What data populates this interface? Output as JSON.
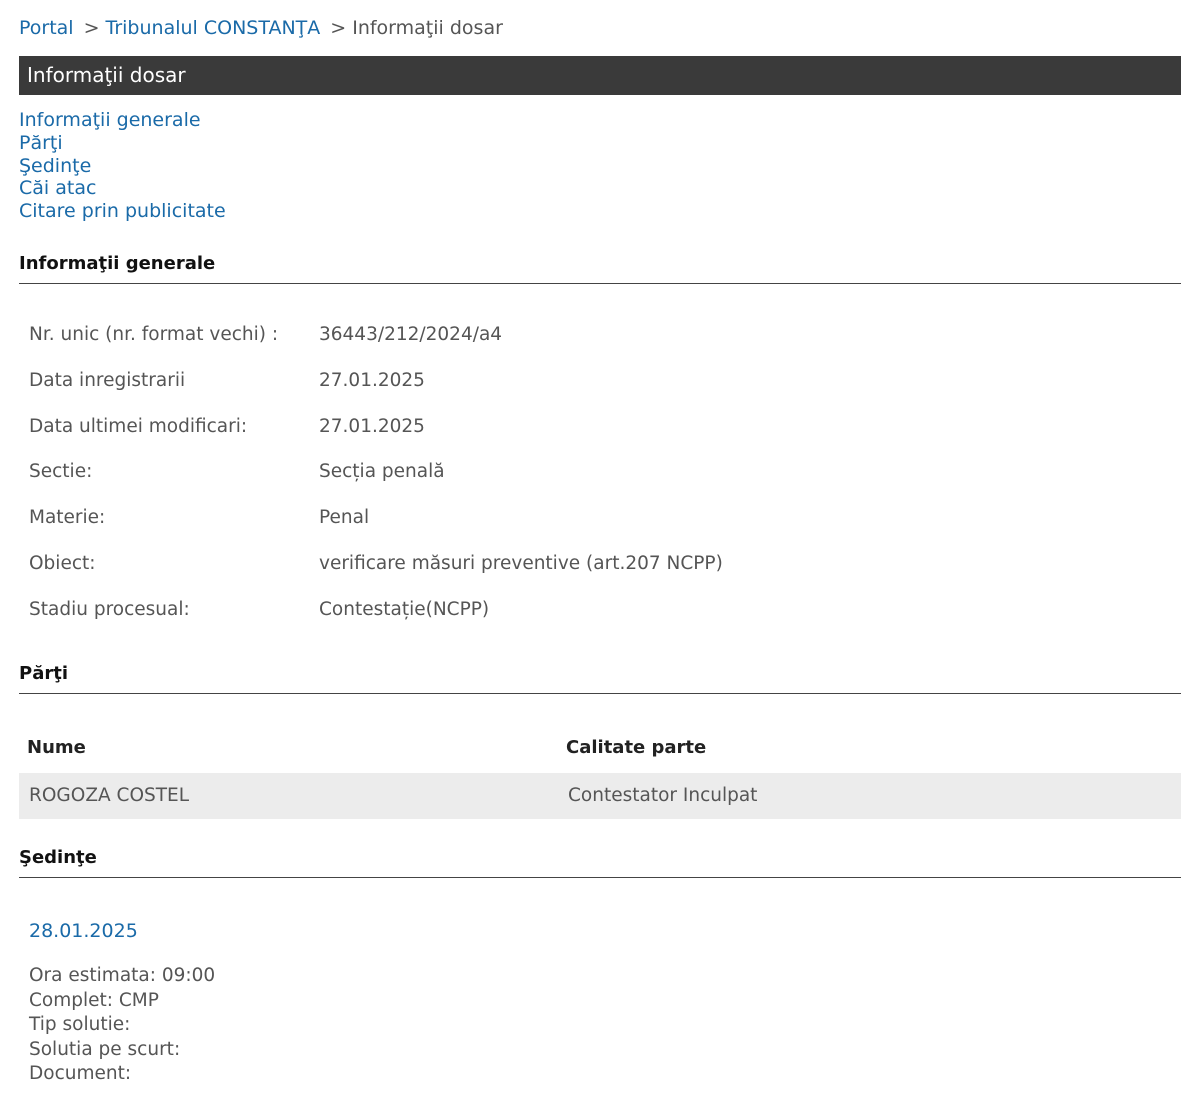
{
  "breadcrumb": {
    "portal": "Portal",
    "court": "Tribunalul CONSTANŢA",
    "current": "Informaţii dosar",
    "separator": ">"
  },
  "title": "Informaţii dosar",
  "section_nav": [
    "Informaţii generale",
    "Părţi",
    "Şedinţe",
    "Căi atac",
    "Citare prin publicitate"
  ],
  "general": {
    "header": "Informaţii generale",
    "rows": [
      {
        "label": "Nr. unic (nr. format vechi) :",
        "value": "36443/212/2024/a4"
      },
      {
        "label": "Data inregistrarii",
        "value": "27.01.2025"
      },
      {
        "label": "Data ultimei modificari:",
        "value": "27.01.2025"
      },
      {
        "label": "Sectie:",
        "value": "Secția penală"
      },
      {
        "label": "Materie:",
        "value": "Penal"
      },
      {
        "label": "Obiect:",
        "value": "verificare măsuri preventive (art.207 NCPP)"
      },
      {
        "label": "Stadiu procesual:",
        "value": "Contestație(NCPP)"
      }
    ]
  },
  "parties": {
    "header": "Părţi",
    "col_name": "Nume",
    "col_role": "Calitate parte",
    "rows": [
      {
        "name": "ROGOZA COSTEL",
        "role": "Contestator Inculpat"
      }
    ]
  },
  "hearings": {
    "header": "Şedinţe",
    "date": "28.01.2025",
    "details": [
      "Ora estimata: 09:00",
      "Complet: CMP",
      "Tip solutie:",
      "Solutia pe scurt:",
      "Document:"
    ]
  },
  "colors": {
    "link": "#1a6aa8",
    "title_bar": "#3a3a3a",
    "row_bg": "#ececec",
    "text_muted": "#555555"
  }
}
